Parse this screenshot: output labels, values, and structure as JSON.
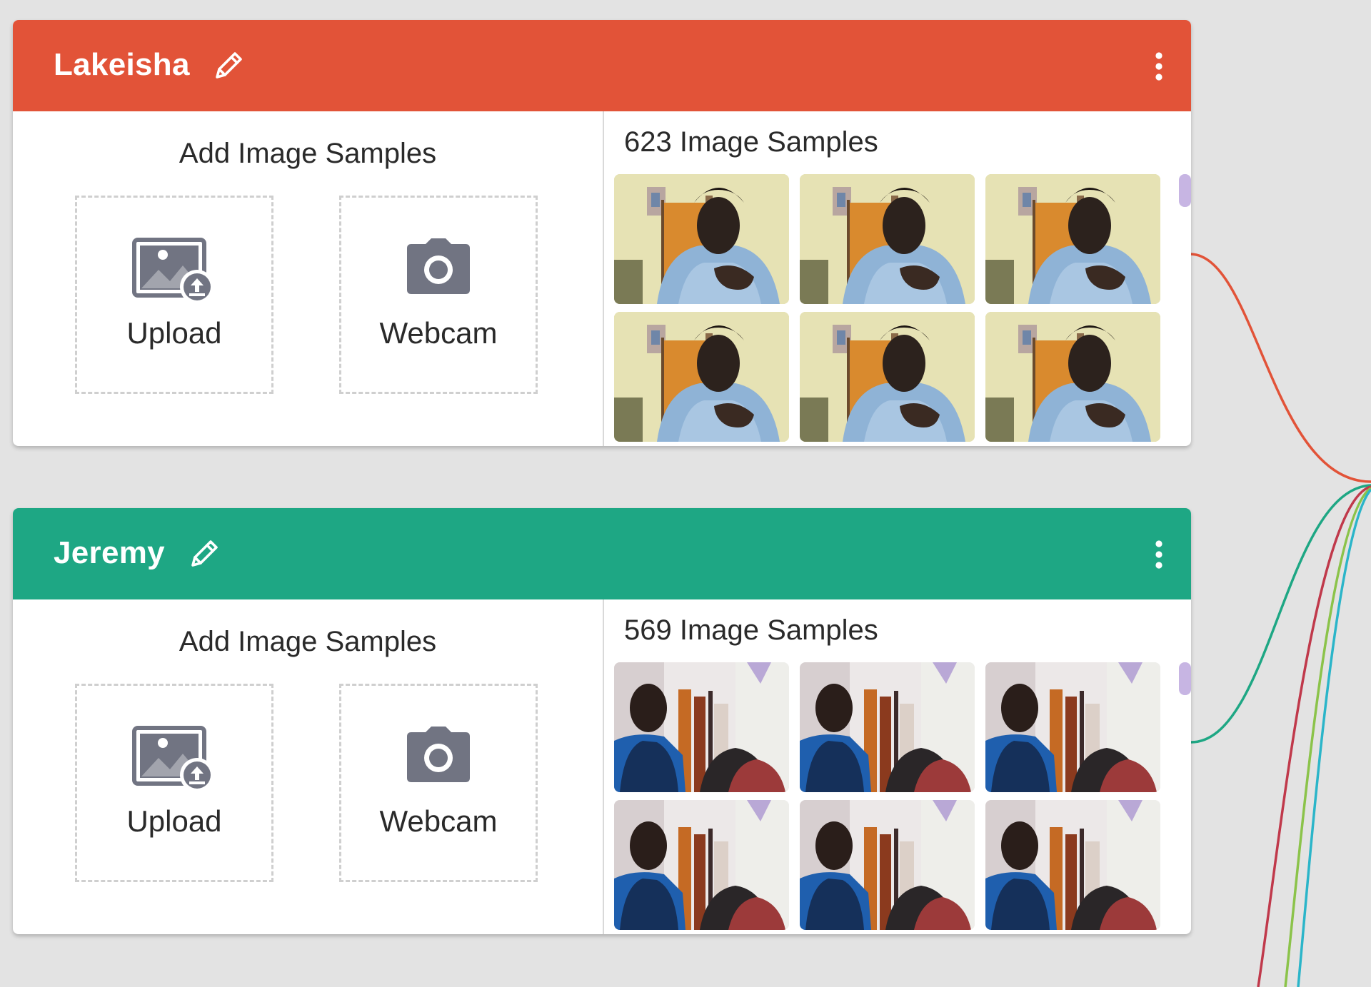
{
  "colors": {
    "background": "#e3e3e3",
    "wire_pink": "#c0394b",
    "wire_lime": "#8bc34a",
    "wire_cyan": "#2bb5c9"
  },
  "classes": [
    {
      "name": "Lakeisha",
      "color": "#e25338",
      "add_title": "Add Image Samples",
      "upload_label": "Upload",
      "webcam_label": "Webcam",
      "sample_count": "623 Image Samples",
      "icons": [
        "pencil-icon",
        "more-vertical-icon",
        "image-upload-icon",
        "camera-icon"
      ]
    },
    {
      "name": "Jeremy",
      "color": "#1ea784",
      "add_title": "Add Image Samples",
      "upload_label": "Upload",
      "webcam_label": "Webcam",
      "sample_count": "569 Image Samples",
      "icons": [
        "pencil-icon",
        "more-vertical-icon",
        "image-upload-icon",
        "camera-icon"
      ]
    }
  ]
}
